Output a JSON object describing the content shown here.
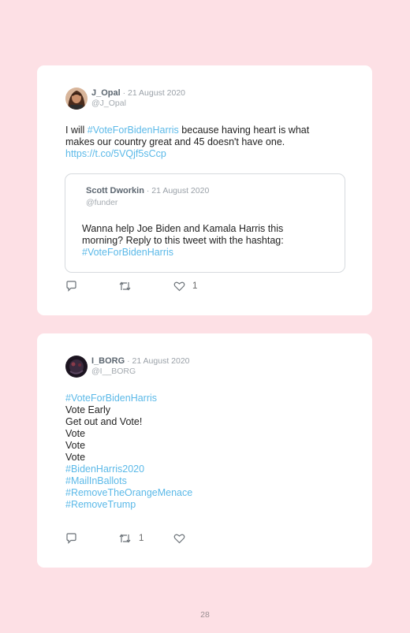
{
  "tweets": [
    {
      "name": "J_Opal",
      "date": "21 August 2020",
      "handle": "@J_Opal",
      "text_lines": [
        [
          {
            "t": "I will ",
            "link": false
          },
          {
            "t": "#VoteForBidenHarris",
            "link": true
          },
          {
            "t": " because having heart is what",
            "link": false
          }
        ],
        [
          {
            "t": "makes our country great and 45 doesn't have one.",
            "link": false
          }
        ],
        [
          {
            "t": "https://t.co/5VQjf5sCcp",
            "link": true
          }
        ]
      ],
      "quote": {
        "name": "Scott Dworkin",
        "date": "21 August 2020",
        "handle": "@funder",
        "text_lines": [
          [
            {
              "t": "Wanna help Joe Biden and Kamala Harris this",
              "link": false
            }
          ],
          [
            {
              "t": "morning? Reply to this tweet with the hashtag:",
              "link": false
            }
          ],
          [
            {
              "t": "#VoteForBidenHarris",
              "link": true
            }
          ]
        ]
      },
      "actions": {
        "reply_count": "",
        "retweet_count": "",
        "like_count": "1"
      }
    },
    {
      "name": "I_BORG",
      "date": "21 August 2020",
      "handle": "@I__BORG",
      "text_lines": [
        [
          {
            "t": "#VoteForBidenHarris",
            "link": true
          }
        ],
        [
          {
            "t": "Vote Early",
            "link": false
          }
        ],
        [
          {
            "t": "Get out and Vote!",
            "link": false
          }
        ],
        [
          {
            "t": "Vote",
            "link": false
          }
        ],
        [
          {
            "t": "Vote",
            "link": false
          }
        ],
        [
          {
            "t": "Vote",
            "link": false
          }
        ],
        [
          {
            "t": "#BidenHarris2020",
            "link": true
          }
        ],
        [
          {
            "t": "#MailInBallots",
            "link": true
          }
        ],
        [
          {
            "t": "#RemoveTheOrangeMenace",
            "link": true
          }
        ],
        [
          {
            "t": "#RemoveTrump",
            "link": true
          }
        ]
      ],
      "actions": {
        "reply_count": "",
        "retweet_count": "1",
        "like_count": ""
      }
    }
  ],
  "page_number": "28",
  "colors": {
    "background": "#fde0e5",
    "link": "#5bb9e8",
    "card": "#ffffff"
  },
  "icons": [
    "reply-icon",
    "retweet-icon",
    "like-icon"
  ]
}
